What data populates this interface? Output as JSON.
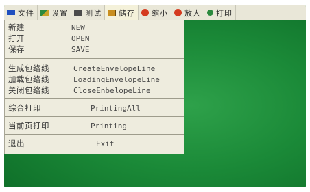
{
  "menubar": {
    "items": [
      {
        "label": "文件",
        "icon": "file-icon"
      },
      {
        "label": "设置",
        "icon": "settings-icon"
      },
      {
        "label": "测试",
        "icon": "test-icon"
      },
      {
        "label": "储存",
        "icon": "storage-icon"
      },
      {
        "label": "缩小",
        "icon": "zoom-out-icon"
      },
      {
        "label": "放大",
        "icon": "zoom-in-icon"
      },
      {
        "label": "打印",
        "icon": "print-icon"
      }
    ]
  },
  "dropdown": {
    "new": {
      "cn": "新建",
      "en": "NEW"
    },
    "open": {
      "cn": "打开",
      "en": "OPEN"
    },
    "save": {
      "cn": "保存",
      "en": "SAVE"
    },
    "create_envelope": {
      "cn": "生成包络线",
      "en": "CreateEnvelopeLine"
    },
    "load_envelope": {
      "cn": "加载包络线",
      "en": "LoadingEnvelopeLine"
    },
    "close_envelope": {
      "cn": "关闭包络线",
      "en": "CloseEnbelopeLine"
    },
    "print_all": {
      "cn": "综合打印",
      "en": "PrintingAll"
    },
    "print_page": {
      "cn": "当前页打印",
      "en": "Printing"
    },
    "exit": {
      "cn": "退出",
      "en": "Exit"
    }
  }
}
